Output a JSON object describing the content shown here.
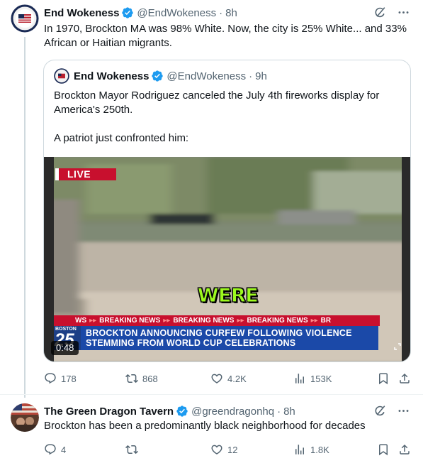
{
  "thread": {
    "main_tweet": {
      "author_name": "End Wokeness",
      "handle": "@EndWokeness",
      "time": "8h",
      "text": "In 1970, Brockton MA was 98% White. Now, the city is 25% White... and 33% African or Haitian migrants.",
      "quote": {
        "author_name": "End Wokeness",
        "handle": "@EndWokeness",
        "time": "9h",
        "text_paragraphs": [
          "Brockton Mayor Rodriguez canceled the July 4th fireworks display for America's 250th.",
          "A patriot just confronted him:"
        ],
        "video": {
          "live_label": "LIVE",
          "caption_word": "WERE",
          "ticker_items": [
            "WS",
            "BREAKING NEWS",
            "BREAKING NEWS",
            "BREAKING NEWS",
            "BR"
          ],
          "station_name": "BOSTON",
          "station_number": "25",
          "headline_lines": [
            "BROCKTON ANNOUNCING CURFEW FOLLOWING VIOLENCE",
            "STEMMING FROM WORLD CUP CELEBRATIONS"
          ],
          "duration": "0:48"
        }
      },
      "stats": {
        "replies": "178",
        "retweets": "868",
        "likes": "4.2K",
        "views": "153K"
      }
    },
    "reply_tweet": {
      "author_name": "The Green Dragon Tavern",
      "handle": "@greendragonhq",
      "time": "8h",
      "text": "Brockton has been a predominantly black neighborhood for decades",
      "stats": {
        "replies": "4",
        "retweets": "",
        "likes": "12",
        "views": "1.8K"
      }
    }
  },
  "separator": "·",
  "colors": {
    "accent_blue": "#1d9bf0",
    "text_primary": "#0f1419",
    "text_secondary": "#536471",
    "border": "#cfd9de",
    "news_red": "#c8102e",
    "news_blue": "#1b49a8",
    "caption_green": "#9dfa1e"
  },
  "icons": [
    "verified-badge-icon",
    "grok-icon",
    "more-icon",
    "reply-icon",
    "retweet-icon",
    "like-icon",
    "views-icon",
    "bookmark-icon",
    "share-icon",
    "expand-icon"
  ]
}
